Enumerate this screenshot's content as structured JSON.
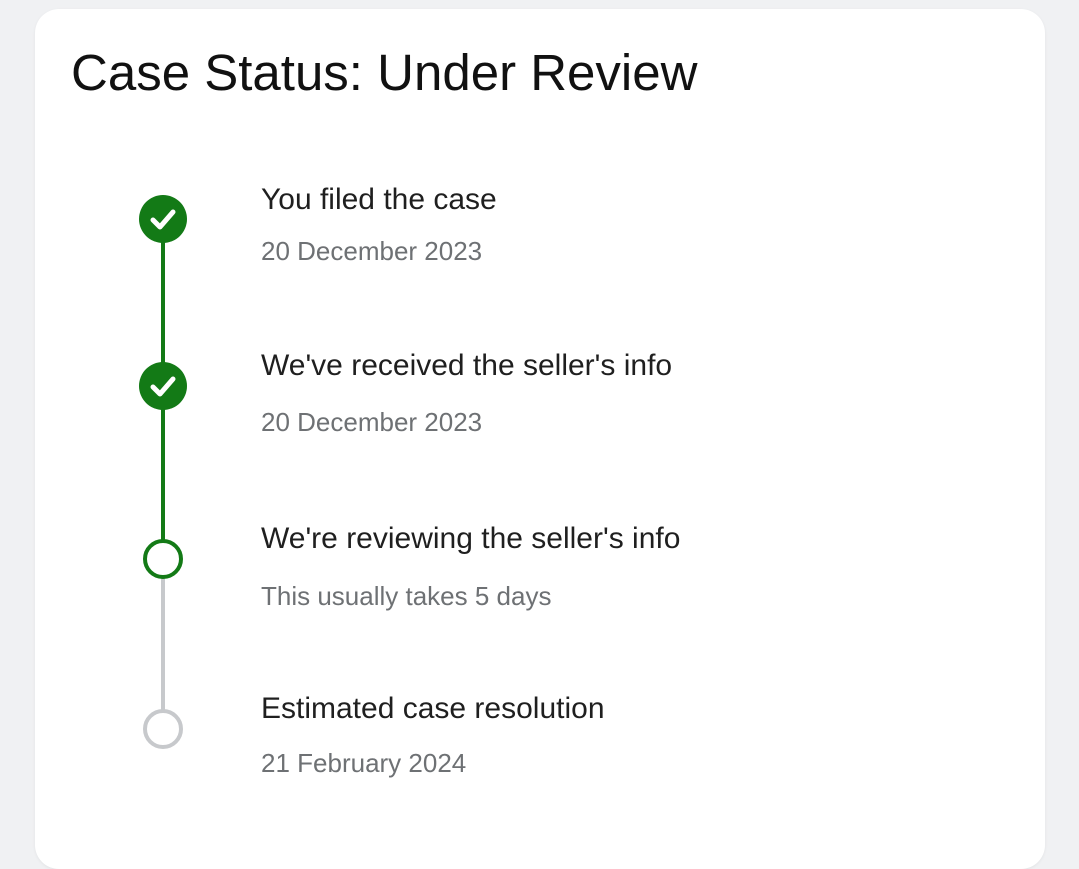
{
  "case": {
    "title": "Case Status: Under Review"
  },
  "colors": {
    "complete": "#137a16",
    "pending": "#c7c9cc",
    "title_text": "#111111",
    "step_text": "#1f1f1f",
    "sub_text": "#6e7174"
  },
  "timeline": {
    "steps": [
      {
        "title": "You filed the case",
        "subtitle": "20 December 2023",
        "state": "complete",
        "icon": "check-icon"
      },
      {
        "title": "We've received the seller's info",
        "subtitle": "20 December 2023",
        "state": "complete",
        "icon": "check-icon"
      },
      {
        "title": "We're reviewing the seller's info",
        "subtitle": "This usually takes 5 days",
        "state": "current",
        "icon": "hollow-circle-icon"
      },
      {
        "title": "Estimated case resolution",
        "subtitle": "21 February 2024",
        "state": "upcoming",
        "icon": "hollow-circle-icon"
      }
    ]
  }
}
